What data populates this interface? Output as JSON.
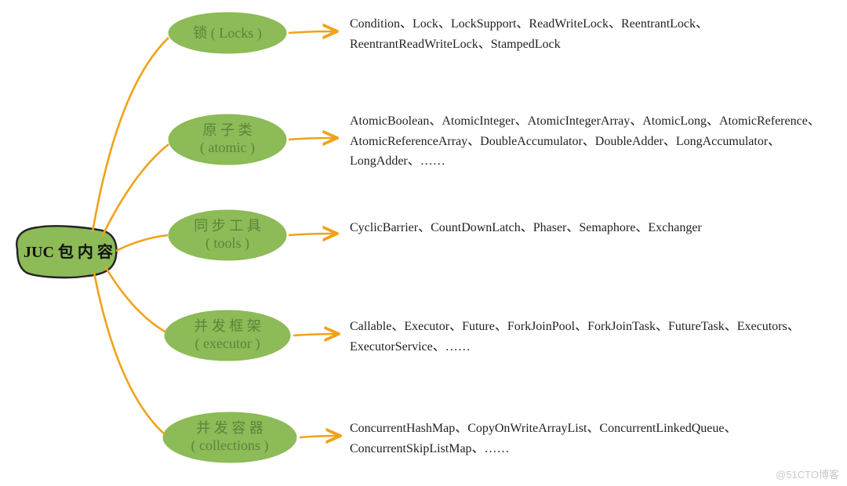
{
  "root": {
    "label": "JUC 包 内 容"
  },
  "branches": [
    {
      "line1": "锁 ( Locks )",
      "line2": ""
    },
    {
      "line1": "原 子 类",
      "line2": "( atomic )"
    },
    {
      "line1": "同 步 工 具",
      "line2": "( tools )"
    },
    {
      "line1": "并 发 框 架",
      "line2": "( executor )"
    },
    {
      "line1": "并 发 容 器",
      "line2": "( collections )"
    }
  ],
  "descriptions": [
    "Condition、Lock、LockSupport、ReadWriteLock、ReentrantLock、ReentrantReadWriteLock、StampedLock",
    "AtomicBoolean、AtomicInteger、AtomicIntegerArray、AtomicLong、AtomicReference、AtomicReferenceArray、DoubleAccumulator、DoubleAdder、LongAccumulator、LongAdder、……",
    "CyclicBarrier、CountDownLatch、Phaser、Semaphore、Exchanger",
    "Callable、Executor、Future、ForkJoinPool、ForkJoinTask、FutureTask、Executors、ExecutorService、……",
    "ConcurrentHashMap、CopyOnWriteArrayList、ConcurrentLinkedQueue、ConcurrentSkipListMap、……"
  ],
  "watermark": "@51CTO博客"
}
